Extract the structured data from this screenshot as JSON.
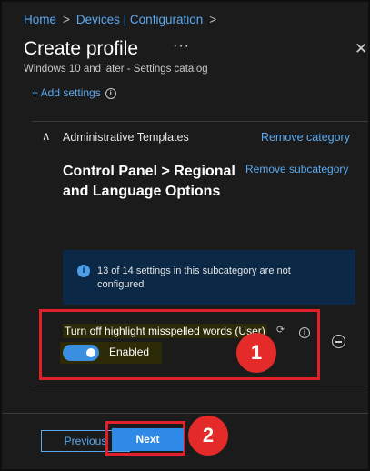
{
  "breadcrumb": {
    "home": "Home",
    "devices": "Devices | Configuration",
    "separator": ">"
  },
  "header": {
    "title": "Create profile",
    "more_label": "···",
    "close_label": "✕",
    "subtitle": "Windows 10 and later - Settings catalog"
  },
  "add_settings": {
    "label": "+ Add settings",
    "info_glyph": "i"
  },
  "category": {
    "name": "Administrative Templates",
    "remove_label": "Remove category",
    "chevron": "∧"
  },
  "subcategory": {
    "name": "Control Panel > Regional and Language Options",
    "remove_label": "Remove subcategory"
  },
  "info_banner": {
    "icon_glyph": "i",
    "text": "13 of 14 settings in this subcategory are not configured"
  },
  "setting": {
    "label": "Turn off highlight misspelled words (User)",
    "value": "Enabled",
    "enabled": true,
    "sync_icon_glyph": "⟳",
    "info_glyph": "i"
  },
  "annotations": {
    "badge1": "1",
    "badge2": "2"
  },
  "footer": {
    "previous_label": "Previous",
    "next_label": "Next"
  },
  "colors": {
    "accent": "#3b8fe0",
    "link": "#5aa9f0",
    "annotation_red": "#e0202a"
  }
}
